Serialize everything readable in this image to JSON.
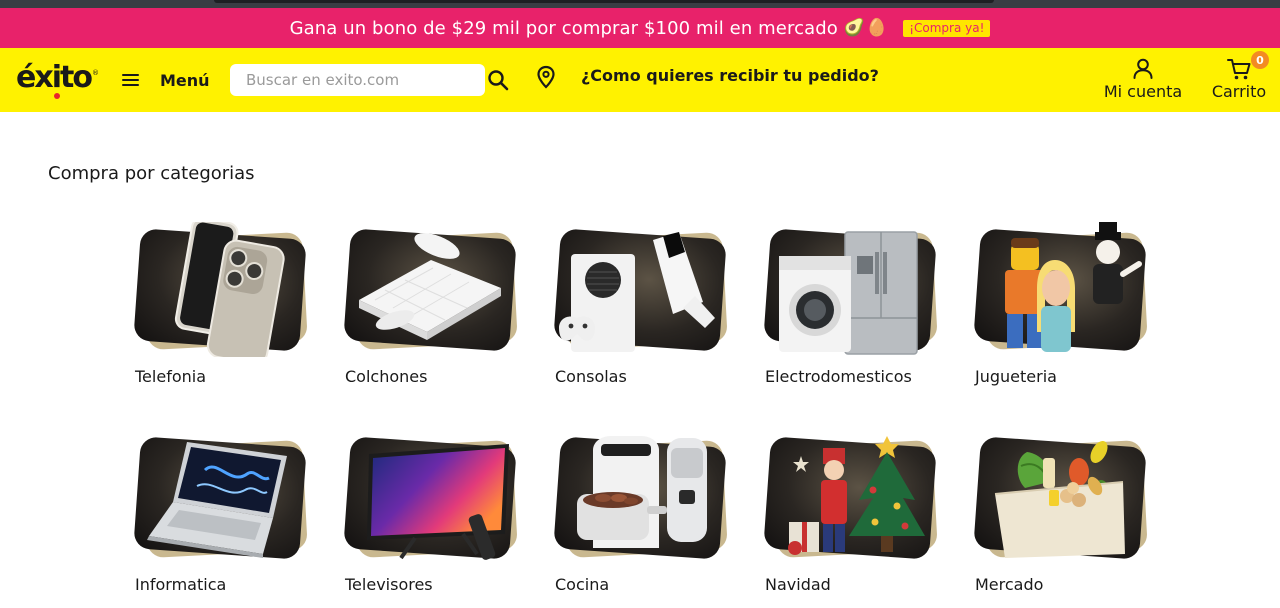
{
  "promo": {
    "text": "Gana un bono de $29 mil por comprar $100 mil en mercado",
    "icons": [
      "avocado-icon",
      "egg-icon"
    ],
    "cta": "¡Compra ya!",
    "background": "#e8226a"
  },
  "header": {
    "logo": "éxito",
    "menu_label": "Menú",
    "search_placeholder": "Buscar en exito.com",
    "delivery_prompt": "¿Como quieres recibir tu pedido?",
    "account_label": "Mi cuenta",
    "cart_label": "Carrito",
    "cart_count": "0",
    "background": "#fff200"
  },
  "main": {
    "section_title": "Compra por categorias",
    "categories": [
      {
        "label": "Telefonia",
        "icon": "smartphone-icon"
      },
      {
        "label": "Colchones",
        "icon": "mattress-icon"
      },
      {
        "label": "Consolas",
        "icon": "game-console-icon"
      },
      {
        "label": "Electrodomesticos",
        "icon": "appliances-icon"
      },
      {
        "label": "Jugueteria",
        "icon": "toys-icon"
      },
      {
        "label": "Informatica",
        "icon": "laptop-icon"
      },
      {
        "label": "Televisores",
        "icon": "television-icon"
      },
      {
        "label": "Cocina",
        "icon": "kitchen-appliances-icon"
      },
      {
        "label": "Navidad",
        "icon": "christmas-tree-icon"
      },
      {
        "label": "Mercado",
        "icon": "grocery-bag-icon"
      }
    ]
  }
}
